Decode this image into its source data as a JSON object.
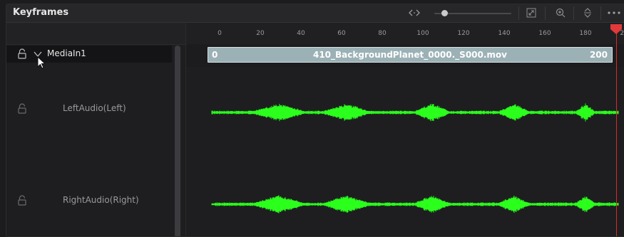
{
  "panel": {
    "title": "Keyframes",
    "toolbar": {
      "icons": [
        "fit-width-icon",
        "zoom-slider",
        "expand-icon",
        "zoom-in-icon",
        "collapse-icon",
        "more-options-icon"
      ],
      "zoom_level": 0.15
    }
  },
  "tracks": [
    {
      "name": "MediaIn1",
      "expanded": true,
      "selected": true,
      "locked": false
    },
    {
      "name": "LeftAudio(Left)",
      "expanded": false,
      "selected": false,
      "locked": false
    },
    {
      "name": "RightAudio(Right)",
      "expanded": false,
      "selected": false,
      "locked": false
    }
  ],
  "ruler": {
    "ticks": [
      "0",
      "20",
      "40",
      "60",
      "80",
      "100",
      "120",
      "140",
      "160",
      "180",
      "200"
    ]
  },
  "clip": {
    "name": "410_BackgroundPlanet_0000._S000.mov",
    "start_frame": "0",
    "end_frame": "200"
  },
  "playhead": {
    "frame": 195
  },
  "colors": {
    "waveform": "#2bff1c",
    "playhead": "#d82a2a",
    "clip_fill": "#9bb1b6"
  }
}
